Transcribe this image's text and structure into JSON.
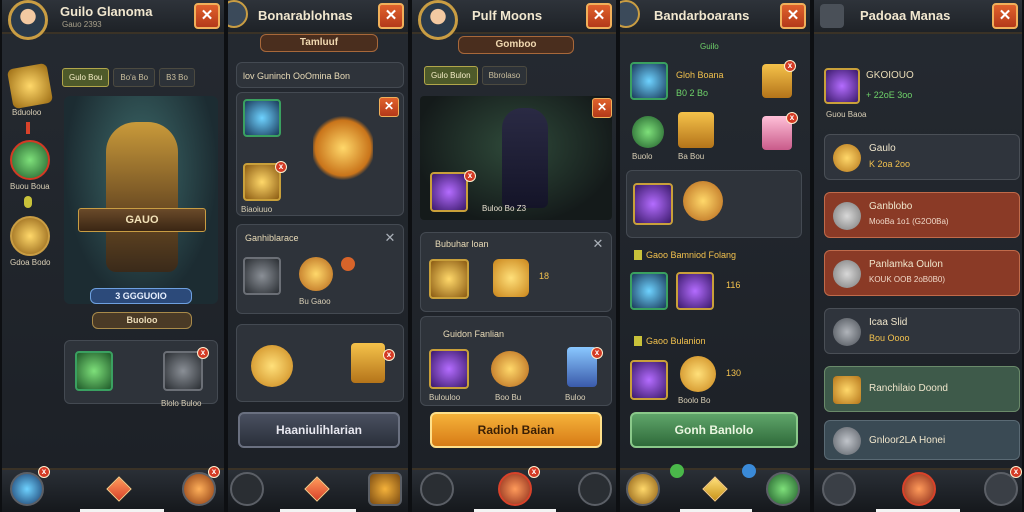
{
  "panels": [
    {
      "title": "Guilo Glanoma",
      "subtitle": "Gauo 2393",
      "close": "✕",
      "tabs": [
        "Gulo Bou",
        "Bo'a Bo",
        "B3 Bo"
      ],
      "side_labels": [
        "Bduoloo",
        "Buou Boua",
        "Gdoa Bodo"
      ],
      "hero_name": "GAUO",
      "hero_power": "3 GGGUOIO",
      "hero_button": "Buoloo",
      "item_label": "Blolo Buloo"
    },
    {
      "title": "Bonarablohnas",
      "tab_banner": "Tamluuf",
      "header": "lov Guninch OoOmina Bon",
      "card1_label": "Biaoiuuo",
      "card2_header": "Ganhiblarace",
      "card2_label": "Bu Gaoo",
      "button": "Haaniulihlarian"
    },
    {
      "title": "Pulf Moons",
      "tab_banner": "Gomboo",
      "tabs": [
        "Gulo Bulon",
        "Bbrolaso"
      ],
      "scene_label": "Buloo Bo Z3",
      "card1_header": "Bubuhar loan",
      "card1_value": "18",
      "card2_header": "Guidon Fanlian",
      "card2_labels": [
        "Bulouloo",
        "Boo Bu",
        "Buloo"
      ],
      "button": "Radioh Baian"
    },
    {
      "title": "Bandarboarans",
      "section": "Guilo",
      "top_item_name": "Gloh Boana",
      "top_item_sub": "B0 2 Bo",
      "row_labels": [
        "Buolo",
        "Ba Bou"
      ],
      "list1_title": "Gaoo Bamniod Folang",
      "list1_value": "116",
      "list2_title": "Gaoo Bulanion",
      "list2_value": "130",
      "list2_label": "Boolo Bo",
      "button": "Gonh Banlolo"
    },
    {
      "title": "Padoaa Manas",
      "top_title": "GKOIOUO",
      "top_sub": "+ 22oE 3oo",
      "top_label": "Guou Baoa",
      "rows": [
        {
          "title": "Gaulo",
          "sub": "K 2oa 2oo"
        },
        {
          "title": "Ganblobo",
          "sub": "MooBa 1o1 (G2O0Ba)"
        },
        {
          "title": "Panlamka Oulon",
          "sub": "KOUK OOB 2oB0B0)"
        },
        {
          "title": "Icaa Slid",
          "sub": "Bou Oooo"
        },
        {
          "title": "Ranchilaio Doond",
          "sub": ""
        },
        {
          "title": "Gnloor2LA Honei",
          "sub": ""
        }
      ]
    }
  ],
  "colors": {
    "accent_orange": "#e0622c",
    "gold": "#f2c14e",
    "panel_bg": "#252a31",
    "green": "#5fa56a"
  }
}
